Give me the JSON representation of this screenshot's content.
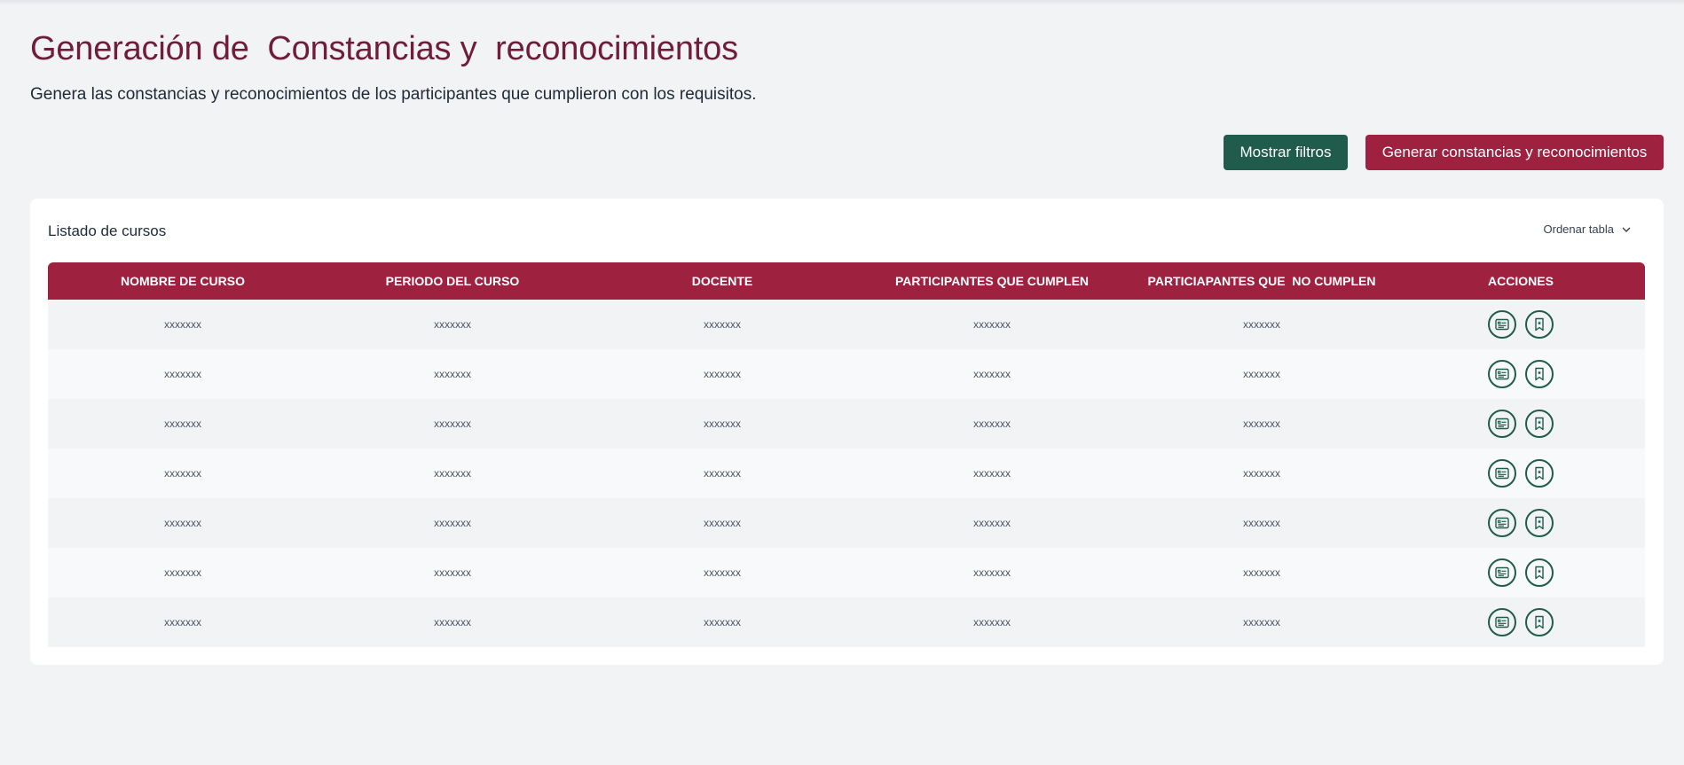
{
  "header": {
    "title": "Generación de  Constancias y  reconocimientos",
    "subtitle": "Genera las constancias y reconocimientos de los participantes que cumplieron con los requisitos."
  },
  "toolbar": {
    "filters_label": "Mostrar filtros",
    "generate_label": "Generar constancias y reconocimientos"
  },
  "card": {
    "title": "Listado de cursos",
    "sort_label": "Ordenar tabla"
  },
  "table": {
    "columns": [
      "NOMBRE DE CURSO",
      "PERIODO DEL CURSO",
      "DOCENTE",
      "PARTICIPANTES QUE CUMPLEN",
      "PARTICIAPANTES QUE  NO CUMPLEN",
      "ACCIONES"
    ],
    "rows": [
      [
        "xxxxxxx",
        "xxxxxxx",
        "xxxxxxx",
        "xxxxxxx",
        "xxxxxxx"
      ],
      [
        "xxxxxxx",
        "xxxxxxx",
        "xxxxxxx",
        "xxxxxxx",
        "xxxxxxx"
      ],
      [
        "xxxxxxx",
        "xxxxxxx",
        "xxxxxxx",
        "xxxxxxx",
        "xxxxxxx"
      ],
      [
        "xxxxxxx",
        "xxxxxxx",
        "xxxxxxx",
        "xxxxxxx",
        "xxxxxxx"
      ],
      [
        "xxxxxxx",
        "xxxxxxx",
        "xxxxxxx",
        "xxxxxxx",
        "xxxxxxx"
      ],
      [
        "xxxxxxx",
        "xxxxxxx",
        "xxxxxxx",
        "xxxxxxx",
        "xxxxxxx"
      ],
      [
        "xxxxxxx",
        "xxxxxxx",
        "xxxxxxx",
        "xxxxxxx",
        "xxxxxxx"
      ]
    ],
    "row_actions": [
      "certificate-icon",
      "bookmark-icon"
    ]
  },
  "colors": {
    "primary": "#9e2240",
    "secondary": "#1f5c4b",
    "title": "#6f1d38",
    "background": "#f2f3f5"
  }
}
